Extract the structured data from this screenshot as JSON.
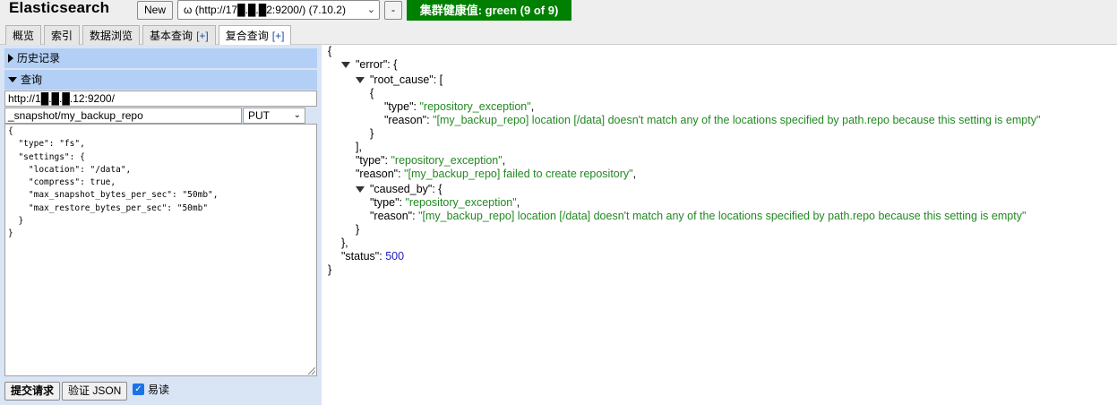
{
  "header": {
    "app_title": "Elasticsearch",
    "new_button": "New",
    "cluster_select": "ω (http://17█.█.█2:9200/) (7.10.2)",
    "minus_button": "-",
    "health": "集群健康值: green (9 of 9)",
    "health_color": "#008000"
  },
  "tabs": [
    {
      "label": "概览",
      "plus": ""
    },
    {
      "label": "索引",
      "plus": ""
    },
    {
      "label": "数据浏览",
      "plus": ""
    },
    {
      "label": "基本查询",
      "plus": "[+]"
    },
    {
      "label": "复合查询",
      "plus": "[+]",
      "active": true
    }
  ],
  "left": {
    "history_header": "历史记录",
    "query_header": "查询",
    "url_value": "http://1█.█.█.12:9200/",
    "path_value": "_snapshot/my_backup_repo",
    "method": "PUT",
    "body_lines": [
      "{",
      "  \"type\": \"fs\",",
      "  \"settings\": {",
      "    \"location\": \"/data\",",
      "    \"compress\": true,",
      "    \"max_snapshot_bytes_per_sec\": \"50mb\",",
      "    \"max_restore_bytes_per_sec\": \"50mb\"",
      "  }",
      "}"
    ],
    "submit_button": "提交请求",
    "validate_button": "验证 JSON",
    "pretty_label": "易读",
    "pretty_checked": true
  },
  "result": {
    "open_brace": "{",
    "error_key": "\"error\"",
    "root_cause_key": "\"root_cause\"",
    "type_key": "\"type\"",
    "reason_key": "\"reason\"",
    "caused_by_key": "\"caused_by\"",
    "status_key": "\"status\"",
    "repository_exception": "\"repository_exception\"",
    "location_reason": "\"[my_backup_repo] location [/data] doesn't match any of the locations specified by path.repo because this setting is empty\"",
    "create_reason": "\"[my_backup_repo] failed to create repository\"",
    "status_value": "500"
  }
}
